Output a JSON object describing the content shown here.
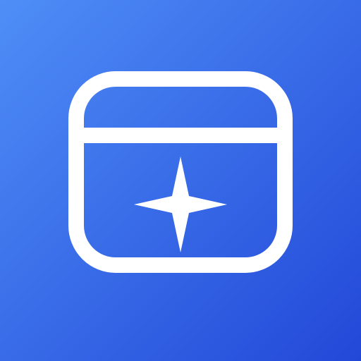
{
  "icon": {
    "name": "browser-window-sparkle-icon",
    "glyph": "window-frame-with-four-point-sparkle"
  },
  "colors": {
    "gradient_start": "#4F8EF7",
    "gradient_end": "#2248D8",
    "foreground": "#FFFFFF"
  }
}
